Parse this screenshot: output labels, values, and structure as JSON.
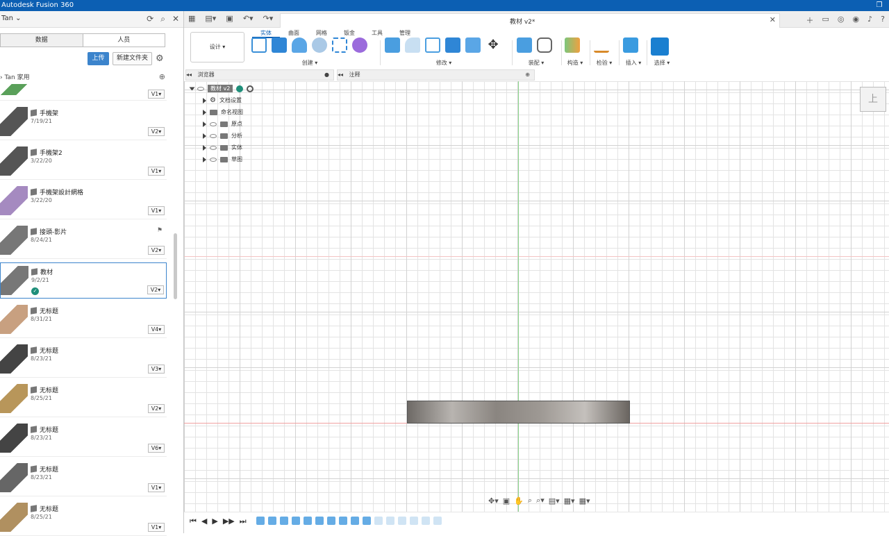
{
  "app": {
    "title": "Autodesk Fusion 360"
  },
  "data_panel": {
    "user": "Tan",
    "tabs": [
      "数据",
      "人员"
    ],
    "upload_label": "上传",
    "new_folder_label": "新建文件夹",
    "breadcrumb": "Tan 家用",
    "files": [
      {
        "name": "",
        "date": "",
        "version": "V1"
      },
      {
        "name": "手機架",
        "date": "7/19/21",
        "version": "V2"
      },
      {
        "name": "手機架2",
        "date": "3/22/20",
        "version": "V1"
      },
      {
        "name": "手機架設計網格",
        "date": "3/22/20",
        "version": "V1"
      },
      {
        "name": "接頭-影片",
        "date": "8/24/21",
        "version": "V2"
      },
      {
        "name": "教材",
        "date": "9/2/21",
        "version": "V2"
      },
      {
        "name": "无标题",
        "date": "8/31/21",
        "version": "V4"
      },
      {
        "name": "无标题",
        "date": "8/23/21",
        "version": "V3"
      },
      {
        "name": "无标题",
        "date": "8/25/21",
        "version": "V2"
      },
      {
        "name": "无标题",
        "date": "8/23/21",
        "version": "V6"
      },
      {
        "name": "无标题",
        "date": "8/23/21",
        "version": "V1"
      },
      {
        "name": "无标题",
        "date": "8/25/21",
        "version": "V1"
      }
    ]
  },
  "document": {
    "tab_title": "教材 v2*"
  },
  "toolbar": {
    "workspace": "设计 ▾",
    "tabs": [
      "实体",
      "曲面",
      "网格",
      "钣金",
      "工具",
      "管理"
    ],
    "groups": [
      "创建 ▾",
      "修改 ▾",
      "装配 ▾",
      "构造 ▾",
      "检验 ▾",
      "插入 ▾",
      "选择 ▾"
    ]
  },
  "panels": {
    "browser": "浏览器",
    "comments": "注释"
  },
  "browser": {
    "root": "教材 v2",
    "nodes": [
      "文档设置",
      "命名视图",
      "原点",
      "分析",
      "实体",
      "草图"
    ]
  },
  "viewcube": {
    "face": "上"
  }
}
